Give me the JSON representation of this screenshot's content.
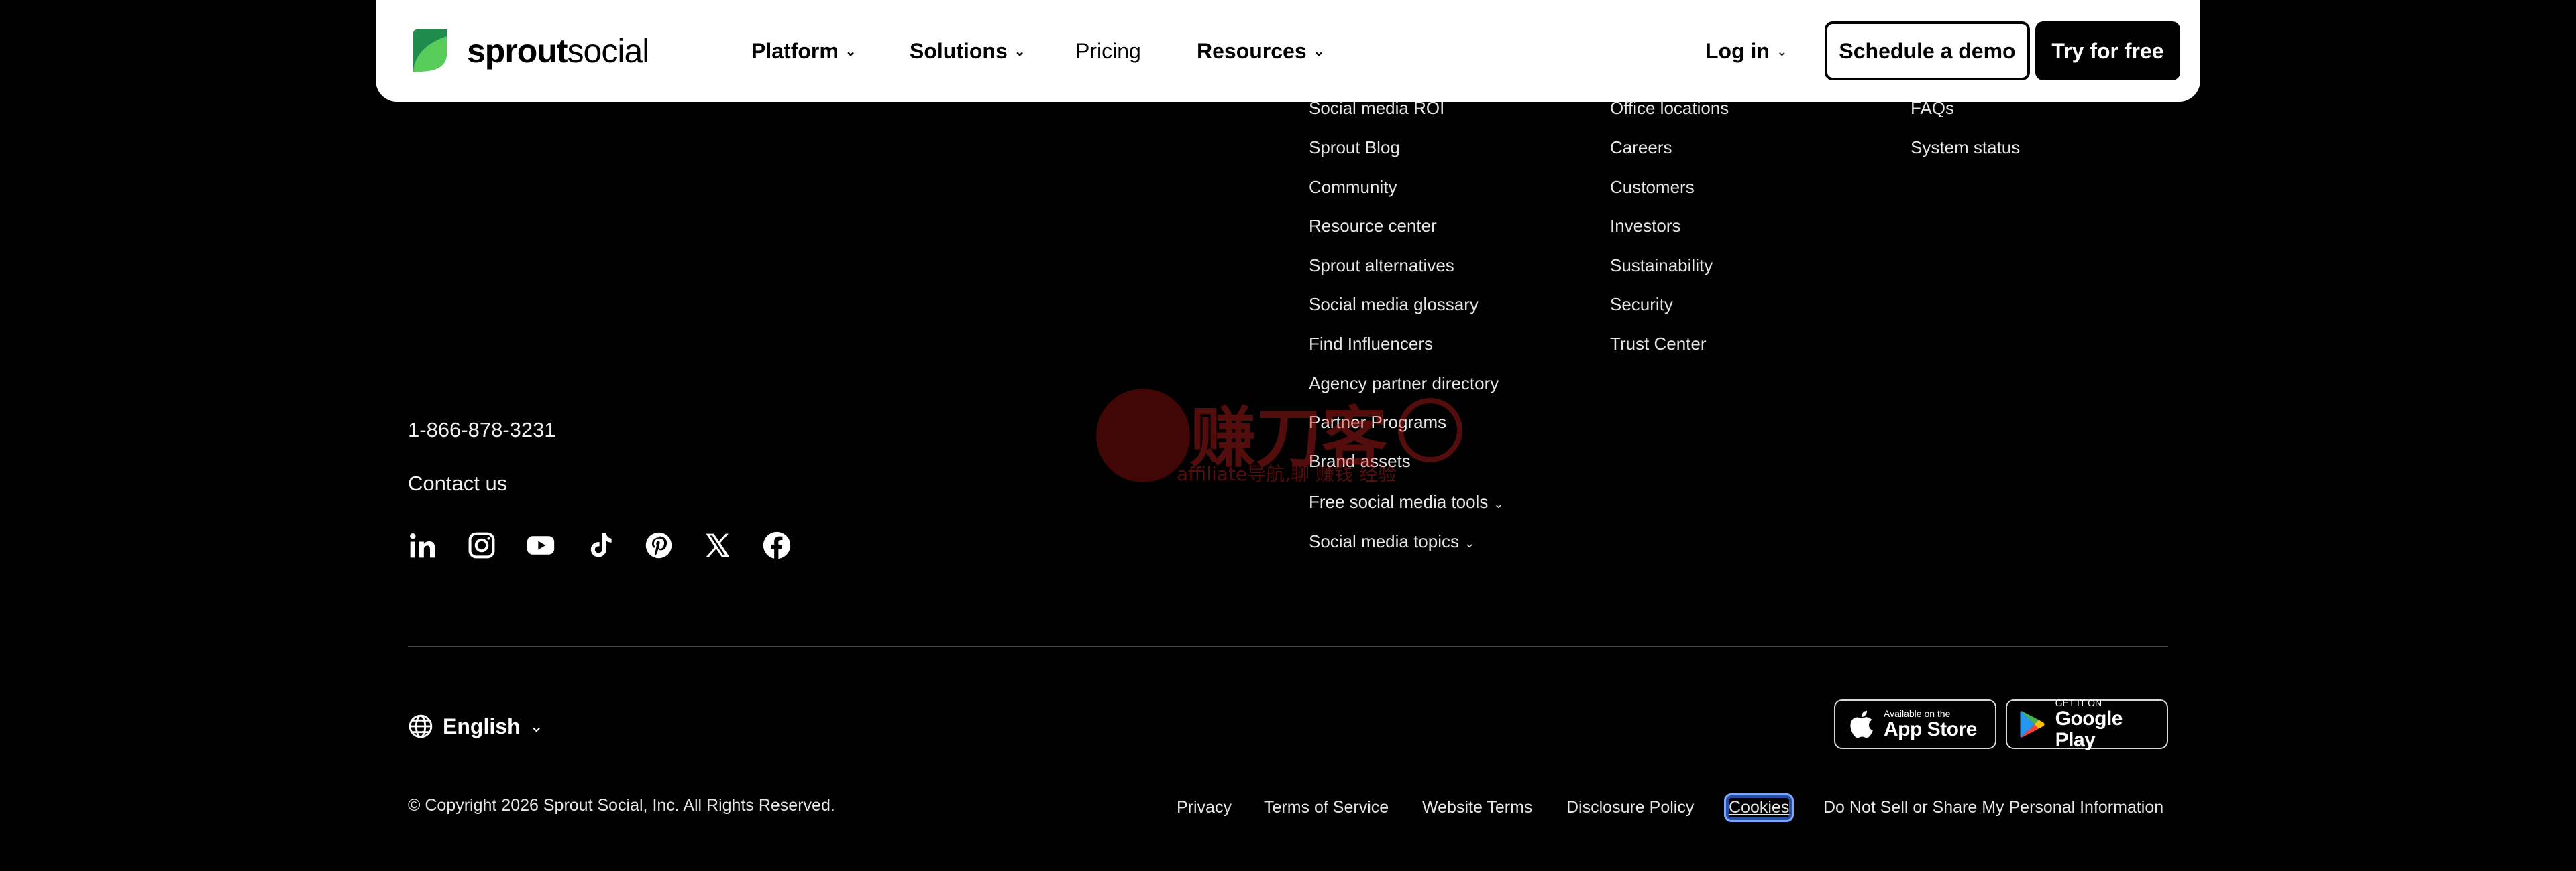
{
  "brand": {
    "name_bold": "sprout",
    "name_light": "social",
    "colors": {
      "leaf_dark": "#1f8b4c",
      "leaf_light": "#59cb59"
    }
  },
  "nav": {
    "platform": "Platform",
    "solutions": "Solutions",
    "pricing": "Pricing",
    "resources": "Resources",
    "login": "Log in",
    "schedule_demo": "Schedule a demo",
    "try_free": "Try for free"
  },
  "columns": {
    "resources": [
      "Social media ROI",
      "Sprout Blog",
      "Community",
      "Resource center",
      "Sprout alternatives",
      "Social media glossary",
      "Find Influencers",
      "Agency partner directory",
      "Partner Programs",
      "Brand assets",
      "Free social media tools",
      "Social media topics"
    ],
    "company": [
      "Office locations",
      "Careers",
      "Customers",
      "Investors",
      "Sustainability",
      "Security",
      "Trust Center"
    ],
    "support": [
      "FAQs",
      "System status"
    ]
  },
  "contact": {
    "phone": "1-866-878-3231",
    "contact_us": "Contact us",
    "socials": [
      "linkedin-icon",
      "instagram-icon",
      "youtube-icon",
      "tiktok-icon",
      "pinterest-icon",
      "x-icon",
      "facebook-icon"
    ]
  },
  "language": {
    "label": "English"
  },
  "stores": {
    "apple_small": "Available on the",
    "apple_big": "App Store",
    "google_small": "GET IT ON",
    "google_big": "Google Play"
  },
  "footer": {
    "copyright": "© Copyright 2026 Sprout Social, Inc. All Rights Reserved.",
    "legal": {
      "privacy": "Privacy",
      "terms": "Terms of Service",
      "website_terms": "Website Terms",
      "disclosure": "Disclosure Policy",
      "cookies": "Cookies",
      "do_not_sell": "Do Not Sell or Share My Personal Information"
    }
  },
  "watermark": {
    "main": "赚刀客",
    "sub": "affiliate导航,聊 赚钱 经验"
  }
}
